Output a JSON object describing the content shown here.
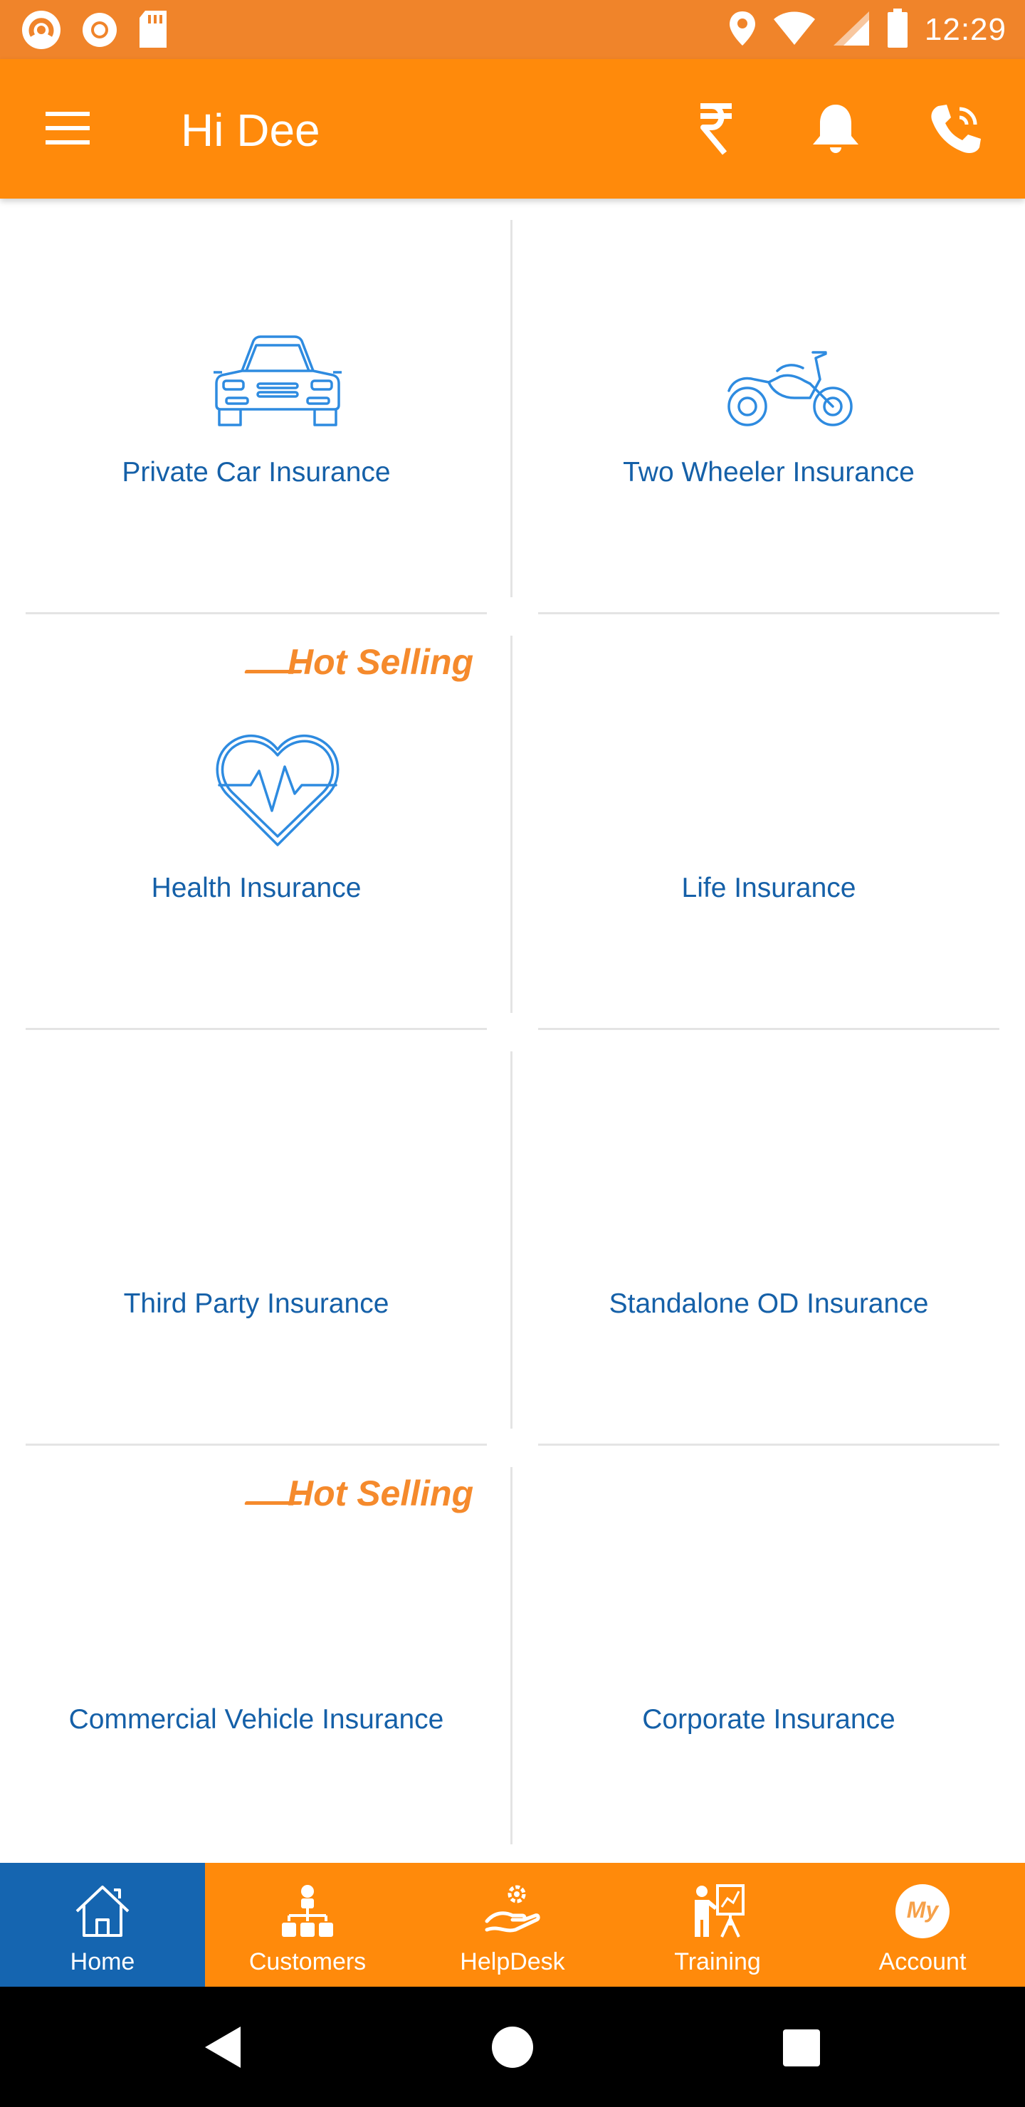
{
  "status_bar": {
    "time": "12:29",
    "left_icons": [
      "app-notification-icon",
      "record-icon",
      "sd-card-icon"
    ],
    "right_icons": [
      "location-icon",
      "wifi-icon",
      "signal-icon",
      "battery-icon"
    ]
  },
  "app_bar": {
    "title": "Hi Dee",
    "actions": [
      "rupee-icon",
      "bell-icon",
      "phone-icon"
    ]
  },
  "insurance_tiles": [
    {
      "label": "Private Car Insurance",
      "icon": "car-icon",
      "badge": ""
    },
    {
      "label": "Two Wheeler Insurance",
      "icon": "motorcycle-icon",
      "badge": ""
    },
    {
      "label": "Health Insurance",
      "icon": "heart-pulse-icon",
      "badge": "Hot Selling"
    },
    {
      "label": "Life Insurance",
      "icon": "",
      "badge": ""
    },
    {
      "label": "Third Party Insurance",
      "icon": "",
      "badge": ""
    },
    {
      "label": "Standalone OD Insurance",
      "icon": "",
      "badge": ""
    },
    {
      "label": "Commercial Vehicle Insurance",
      "icon": "",
      "badge": "Hot Selling"
    },
    {
      "label": "Corporate Insurance",
      "icon": "",
      "badge": ""
    }
  ],
  "bottom_nav": {
    "items": [
      {
        "label": "Home",
        "icon": "home-icon",
        "active": true
      },
      {
        "label": "Customers",
        "icon": "hierarchy-icon",
        "active": false
      },
      {
        "label": "HelpDesk",
        "icon": "helpdesk-icon",
        "active": false
      },
      {
        "label": "Training",
        "icon": "training-icon",
        "active": false
      },
      {
        "label": "Account",
        "icon": "my-account-icon",
        "active": false
      }
    ],
    "account_badge_text": "My"
  },
  "system_nav": [
    "back-icon",
    "home-circle-icon",
    "recents-icon"
  ],
  "colors": {
    "status_bar": "#F0842A",
    "app_bar": "#FF8A0B",
    "active_tab": "#1565B0",
    "label_blue": "#1560A8",
    "icon_blue": "#2E8BE0",
    "hot_selling": "#F58A2C"
  }
}
